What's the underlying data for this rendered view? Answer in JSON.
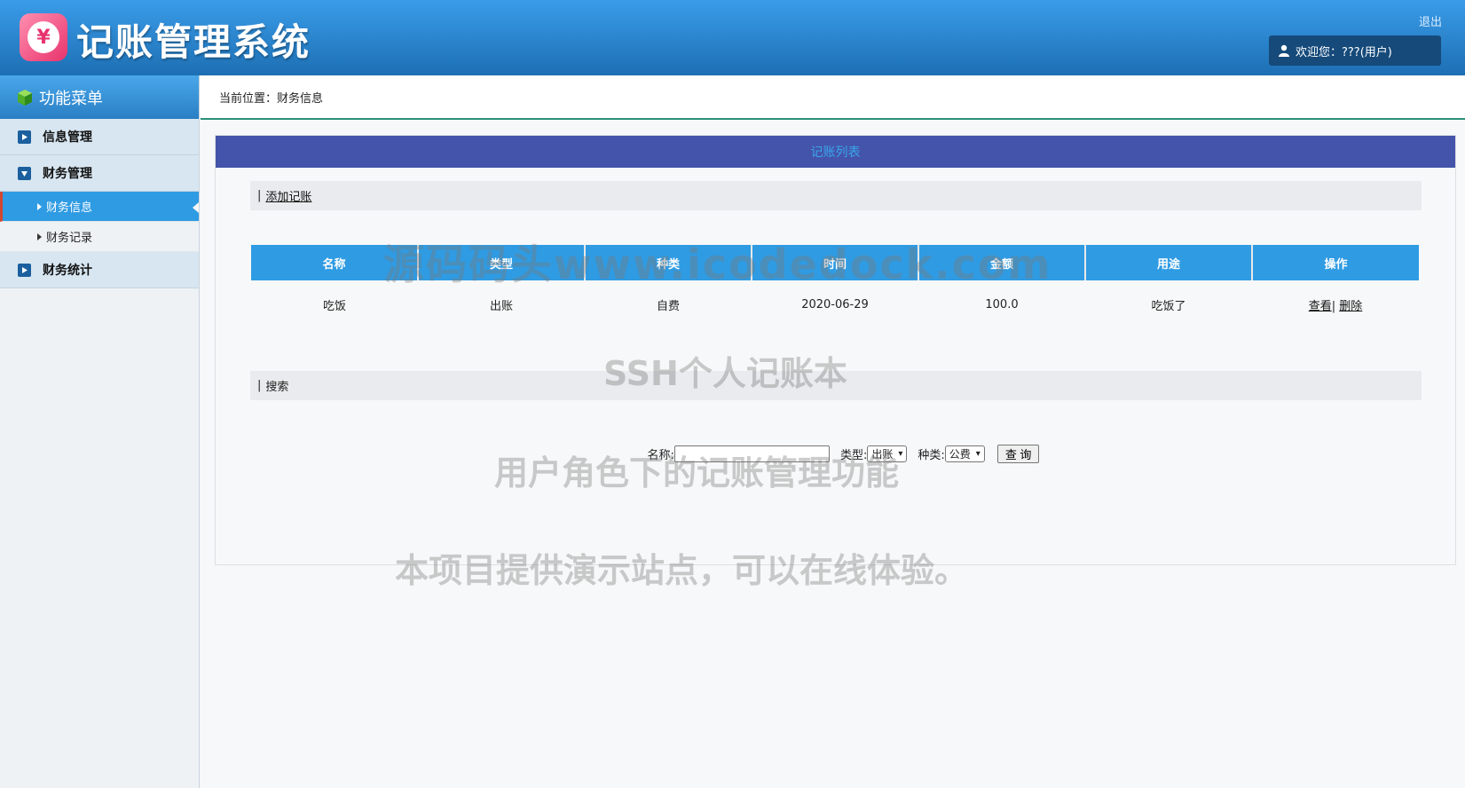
{
  "header": {
    "title": "记账管理系统",
    "logo_glyph": "¥",
    "logout": "退出",
    "welcome": "欢迎您：???(用户)"
  },
  "sidebar": {
    "heading": "功能菜单",
    "groups": [
      {
        "label": "信息管理",
        "expanded": false
      },
      {
        "label": "财务管理",
        "expanded": true,
        "items": [
          "财务信息",
          "财务记录"
        ]
      },
      {
        "label": "财务统计",
        "expanded": false
      }
    ],
    "active_item": "财务信息"
  },
  "breadcrumb": "当前位置：财务信息",
  "panel": {
    "title": "记账列表",
    "add_link": "添加记账",
    "table": {
      "headers": [
        "名称",
        "类型",
        "种类",
        "时间",
        "金额",
        "用途",
        "操作"
      ],
      "rows": [
        {
          "name": "吃饭",
          "type": "出账",
          "kind": "自费",
          "time": "2020-06-29",
          "amount": "100.0",
          "purpose": "吃饭了",
          "view": "查看",
          "delete": "删除"
        }
      ]
    },
    "search_heading": "搜索",
    "search": {
      "name_label": "名称:",
      "name_value": "",
      "type_label": "类型:",
      "type_value": "出账",
      "kind_label": "种类:",
      "kind_value": "公费",
      "button": "查 询"
    }
  },
  "watermarks": [
    "源码码头www.icodedock.com",
    "SSH个人记账本",
    "用户角色下的记账管理功能",
    "本项目提供演示站点，可以在线体验。"
  ],
  "colors": {
    "header": "#2b86d3",
    "accent": "#2f9be3",
    "panel_title": "#4454aa",
    "active_marker": "#d2472f"
  }
}
